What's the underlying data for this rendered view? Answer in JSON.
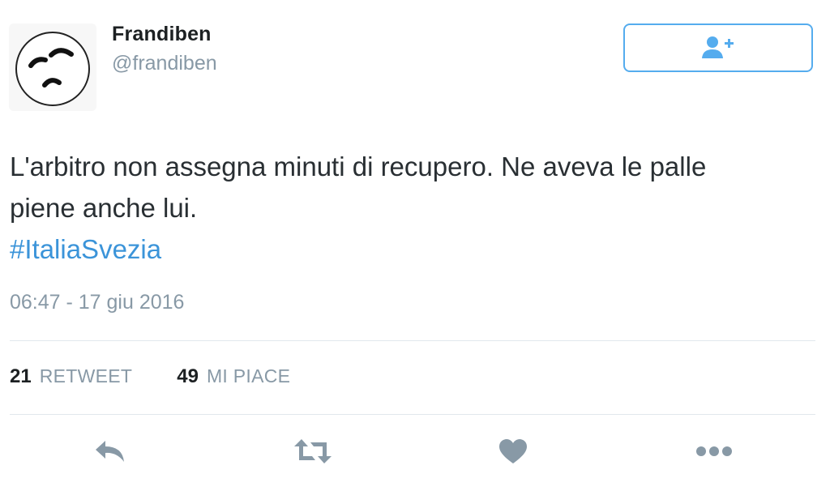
{
  "user": {
    "display_name": "Frandiben",
    "username": "@frandiben",
    "avatar_icon": "face-sketch-avatar"
  },
  "follow_button": {
    "icon": "add-user-icon",
    "color": "#55acee"
  },
  "tweet": {
    "text_line1": "L'arbitro non assegna minuti di recupero. Ne aveva le palle",
    "text_line2": "piene anche lui.",
    "hashtag": "#ItaliaSvezia",
    "timestamp": "06:47 - 17 giu 2016"
  },
  "stats": {
    "retweets_count": "21",
    "retweets_label": "RETWEET",
    "likes_count": "49",
    "likes_label": "MI PIACE"
  },
  "actions": {
    "reply_icon": "reply-icon",
    "retweet_icon": "retweet-icon",
    "like_icon": "heart-icon",
    "more_icon": "more-icon",
    "icon_color": "#8899a6"
  },
  "colors": {
    "link": "#3b94d9",
    "muted": "#8899a6",
    "text": "#292f33",
    "divider": "#e1e8ed"
  }
}
